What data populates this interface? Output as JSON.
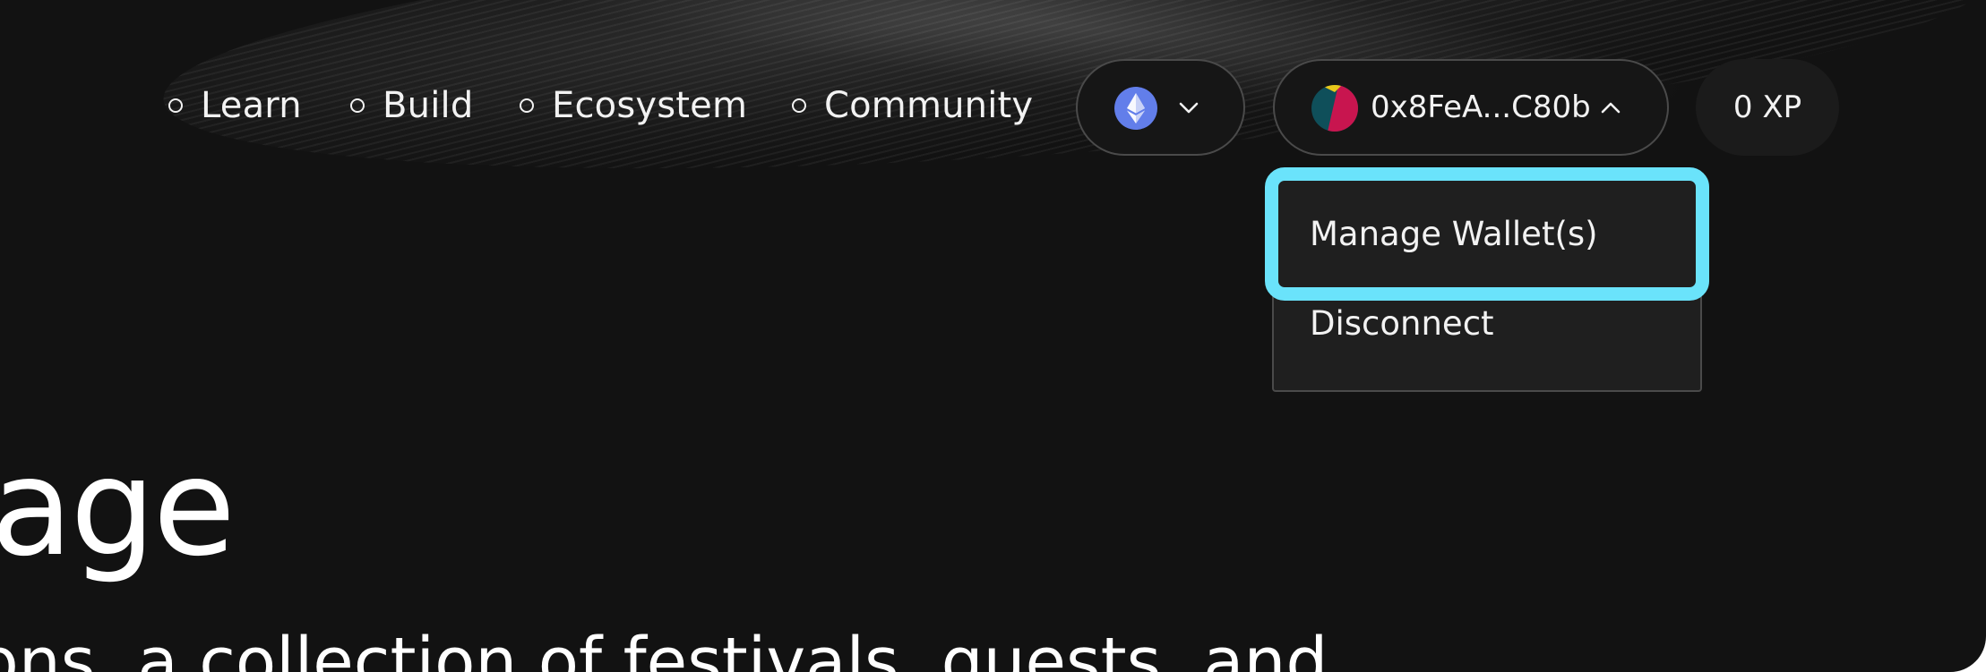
{
  "nav": {
    "items": [
      {
        "label": "Learn"
      },
      {
        "label": "Build"
      },
      {
        "label": "Ecosystem"
      },
      {
        "label": "Community"
      }
    ]
  },
  "network": {
    "icon": "ethereum-icon",
    "color": "#627eea"
  },
  "wallet": {
    "address": "0x8FeA...C80b",
    "avatar_colors": [
      "#0f4f5a",
      "#c8154f",
      "#e9c81a"
    ]
  },
  "xp": {
    "label": "0 XP"
  },
  "wallet_menu": {
    "items": [
      {
        "label": "Manage Wallet(s)",
        "highlighted": true
      },
      {
        "label": "Disconnect"
      }
    ],
    "highlight_color": "#6ae3fb"
  },
  "hero": {
    "title_fragment": "age",
    "subtitle_fragment": "ions, a collection of festivals, quests, and"
  }
}
